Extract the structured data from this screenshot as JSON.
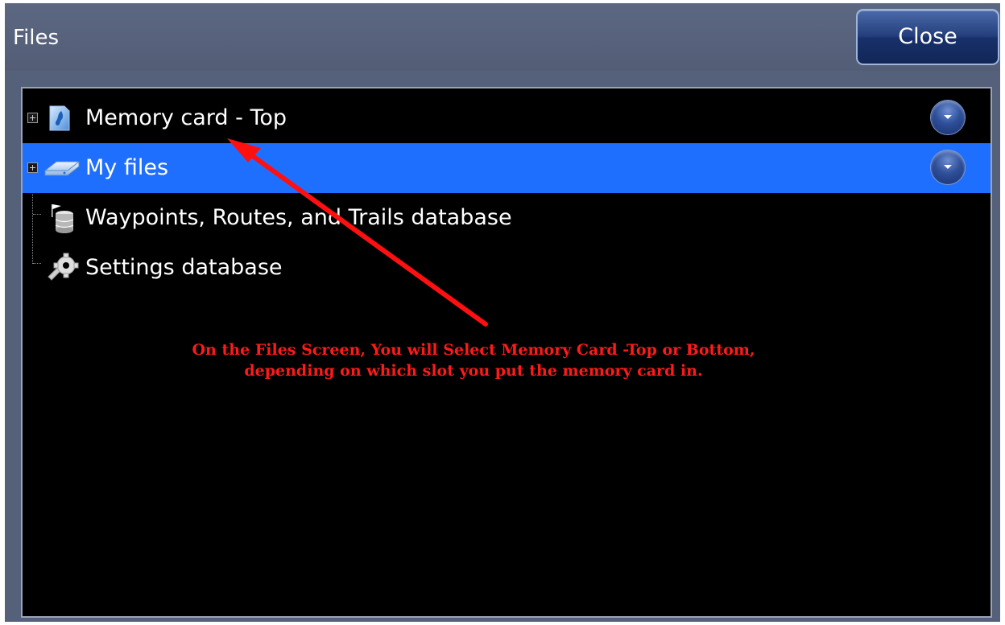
{
  "header": {
    "title": "Files",
    "close_label": "Close"
  },
  "tree": {
    "items": [
      {
        "label": "Memory card - Top",
        "icon": "memory-card-icon",
        "expandable": true,
        "selected": false
      },
      {
        "label": "My files",
        "icon": "drive-icon",
        "expandable": true,
        "selected": true
      },
      {
        "label": "Waypoints, Routes, and Trails database",
        "icon": "database-icon",
        "expandable": false,
        "selected": false
      },
      {
        "label": "Settings database",
        "icon": "settings-icon",
        "expandable": false,
        "selected": false
      }
    ]
  },
  "annotation": {
    "line1": "On the Files Screen, You will Select Memory Card -Top or Bottom,",
    "line2": "depending on which slot you put the memory card in.",
    "color": "#ff1a1a"
  },
  "colors": {
    "selection": "#1f6fff",
    "titlebar": "#55607a",
    "accent": "#243f7c"
  }
}
